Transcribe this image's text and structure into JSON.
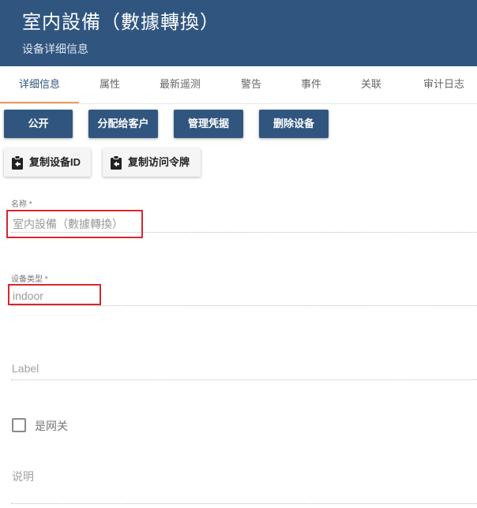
{
  "header": {
    "title": "室内設備（數據轉換）",
    "subtitle": "设备详细信息"
  },
  "tabs": [
    {
      "label": "详细信息",
      "active": true
    },
    {
      "label": "属性"
    },
    {
      "label": "最新遥测"
    },
    {
      "label": "警告"
    },
    {
      "label": "事件"
    },
    {
      "label": "关联"
    },
    {
      "label": "审计日志"
    }
  ],
  "actions": {
    "public": "公开",
    "assign_customer": "分配给客户",
    "manage_credentials": "管理凭据",
    "delete_device": "删除设备",
    "copy_device_id": "复制设备ID",
    "copy_access_token": "复制访问令牌"
  },
  "form": {
    "name_label": "名称 *",
    "name_value": "室内設備（數據轉換）",
    "type_label": "设备类型 *",
    "type_value": "indoor",
    "label_placeholder": "Label",
    "gateway_label": "是网关",
    "gateway_checked": false,
    "description_placeholder": "说明"
  },
  "colors": {
    "header_bg": "#305680",
    "tab_indicator": "#f29b5f",
    "highlight_box": "#d9262c"
  },
  "icons": {
    "copy": "clipboard-arrow-icon"
  }
}
